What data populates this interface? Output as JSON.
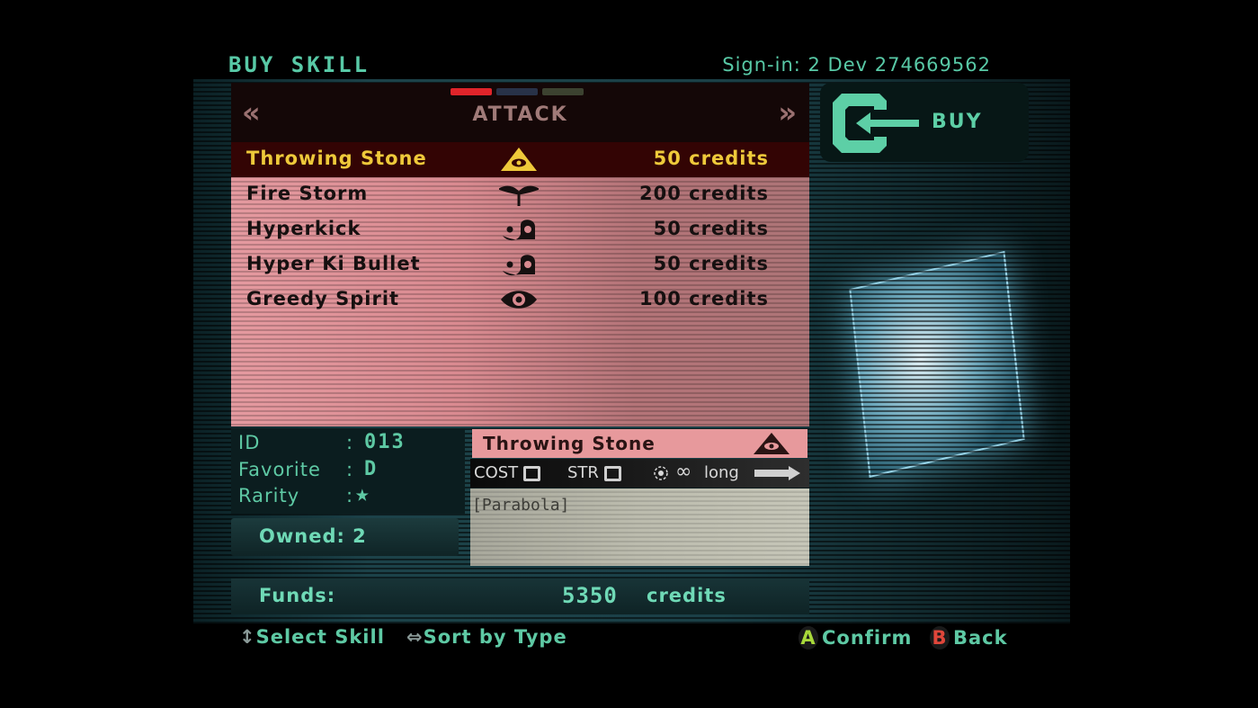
{
  "screen_title": "BUY SKILL",
  "sign_in": "Sign-in: 2 Dev 274669562",
  "category": {
    "title": "ATTACK",
    "prev_icon": "double-chevron-left-icon",
    "next_icon": "double-chevron-right-icon",
    "indicator_colors": [
      "#e0242a",
      "#283248",
      "#3c4230"
    ],
    "active_indicator": 0
  },
  "skills": [
    {
      "name": "Throwing Stone",
      "icon": "eye-pyramid-icon",
      "price": "50 credits",
      "selected": true
    },
    {
      "name": "Fire Storm",
      "icon": "sprout-icon",
      "price": "200 credits",
      "selected": false
    },
    {
      "name": "Hyperkick",
      "icon": "ki-spiral-icon",
      "price": "50 credits",
      "selected": false
    },
    {
      "name": "Hyper Ki Bullet",
      "icon": "ki-spiral-icon",
      "price": "50 credits",
      "selected": false
    },
    {
      "name": "Greedy Spirit",
      "icon": "eye-icon",
      "price": "100 credits",
      "selected": false
    }
  ],
  "info": {
    "id_label": "ID",
    "id_value": "013",
    "favorite_label": "Favorite",
    "favorite_value": "D",
    "rarity_label": "Rarity",
    "rarity_value": "★",
    "colon": ":"
  },
  "owned": "Owned: 2",
  "detail": {
    "title": "Throwing Stone",
    "icon": "eye-pyramid-icon",
    "cost_label": "COST",
    "str_label": "STR",
    "range_icon": "target-icon",
    "uses": "∞",
    "range": "long",
    "description": "[Parabola]"
  },
  "funds": {
    "label": "Funds:",
    "value": "5350",
    "unit": "credits"
  },
  "buy_button": {
    "label": "BUY",
    "icon": "enter-arrow-icon"
  },
  "hints": [
    {
      "glyph": "↕",
      "label": "Select Skill"
    },
    {
      "glyph": "⇔",
      "label": "Sort by Type"
    },
    {
      "button": "A",
      "label": "Confirm",
      "color": "#a8d83a"
    },
    {
      "button": "B",
      "label": "Back",
      "color": "#e0463a"
    }
  ]
}
